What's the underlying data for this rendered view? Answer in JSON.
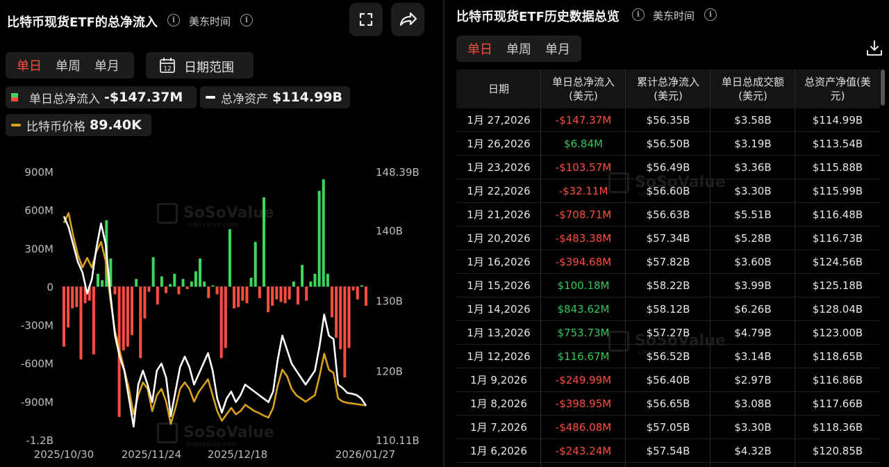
{
  "left": {
    "title": "比特币现货ETF的总净流入",
    "timezone": "美东时间",
    "tabs": [
      "单日",
      "单周",
      "单月"
    ],
    "active_tab": "单日",
    "date_range_label": "日期范围",
    "calendar_day": "12",
    "legend": {
      "daily_label": "单日总净流入",
      "daily_value": "-$147.37M",
      "assets_label": "总净资产",
      "assets_value": "$114.99B",
      "price_label": "比特币价格",
      "price_value": "89.40K"
    },
    "watermark": {
      "brand": "SoSoValue",
      "site": "sosovalue.com"
    }
  },
  "chart_data": {
    "type": "bar",
    "y_left": {
      "ticks": [
        "900M",
        "600M",
        "300M",
        "0",
        "-300M",
        "-600M",
        "-900M",
        "-1.2B"
      ],
      "range_m": [
        -1200,
        900
      ]
    },
    "y_right": {
      "ticks": [
        "148.39B",
        "140B",
        "130B",
        "120B",
        "110.11B"
      ],
      "range_b": [
        110.11,
        148.39
      ]
    },
    "x_labels": [
      "2025/10/30",
      "2025/11/24",
      "2025/12/18",
      "2026/01/27"
    ],
    "flows_m": [
      -470,
      -320,
      -170,
      -160,
      -570,
      -130,
      -110,
      -530,
      100,
      50,
      520,
      220,
      -60,
      -1020,
      -500,
      -470,
      -380,
      60,
      -560,
      -250,
      -40,
      230,
      -140,
      80,
      -50,
      20,
      100,
      -60,
      60,
      -20,
      40,
      120,
      220,
      40,
      -90,
      10,
      -60,
      -560,
      -480,
      450,
      -170,
      -160,
      -110,
      -130,
      70,
      350,
      -90,
      700,
      -200,
      -150,
      -100,
      -120,
      -130,
      -100,
      40,
      -140,
      170,
      -110,
      40,
      100,
      750,
      840,
      100,
      -240,
      -400,
      -490,
      -710,
      -480,
      -30,
      -100,
      10,
      -150
    ],
    "assets_b": [
      142.0,
      140.5,
      138.0,
      135.5,
      134.0,
      131.0,
      133.0,
      137.5,
      141.0,
      138.0,
      131.0,
      125.0,
      122.0,
      120.0,
      116.0,
      112.0,
      118.0,
      120.0,
      118.0,
      115.5,
      120.0,
      121.0,
      119.0,
      113.5,
      117.0,
      120.5,
      122.0,
      120.5,
      118.0,
      119.5,
      121.0,
      122.5,
      120.0,
      116.0,
      114.0,
      116.0,
      117.0,
      115.5,
      116.5,
      118.0,
      117.5,
      117.0,
      116.5,
      116.0,
      115.5,
      117.0,
      121.5,
      125.0,
      123.0,
      121.0,
      120.0,
      119.0,
      118.0,
      119.0,
      120.0,
      123.5,
      128.0,
      125.0,
      124.5,
      118.0,
      117.5,
      116.8,
      116.7,
      116.5,
      116.0,
      114.99
    ],
    "price_k": [
      118.0,
      119.5,
      116.0,
      113.0,
      111.0,
      112.5,
      111.0,
      113.5,
      115.0,
      112.0,
      106.0,
      101.0,
      98.0,
      95.0,
      92.0,
      88.0,
      91.0,
      93.0,
      92.0,
      88.5,
      91.0,
      92.0,
      90.0,
      86.5,
      89.0,
      92.0,
      93.0,
      92.0,
      90.0,
      91.5,
      92.5,
      93.5,
      91.0,
      88.5,
      87.0,
      88.0,
      89.0,
      88.0,
      88.5,
      89.5,
      89.0,
      88.5,
      88.2,
      87.8,
      87.5,
      89.0,
      92.5,
      95.0,
      94.0,
      92.0,
      91.0,
      90.5,
      90.0,
      90.5,
      91.0,
      94.0,
      97.5,
      95.0,
      94.5,
      90.5,
      90.0,
      89.8,
      89.7,
      89.6,
      89.5,
      89.4
    ],
    "price_range_k": [
      84.0,
      126.0
    ],
    "colors": {
      "inflow": "#3dd65c",
      "outflow": "#ff4d40",
      "assets": "#ffffff",
      "price": "#d9a21b"
    }
  },
  "right": {
    "title": "比特币现货ETF历史数据总览",
    "timezone": "美东时间",
    "tabs": [
      "单日",
      "单周",
      "单月"
    ],
    "active_tab": "单日",
    "columns": [
      "日期",
      "单日总净流入\n(美元)",
      "累计总净流入\n(美元)",
      "单日总成交额\n(美元)",
      "总资产净值(美\n元)"
    ],
    "rows": [
      [
        "1月 27,2026",
        "-$147.37M",
        "$56.35B",
        "$3.58B",
        "$114.99B"
      ],
      [
        "1月 26,2026",
        "$6.84M",
        "$56.50B",
        "$3.19B",
        "$113.54B"
      ],
      [
        "1月 23,2026",
        "-$103.57M",
        "$56.49B",
        "$3.36B",
        "$115.88B"
      ],
      [
        "1月 22,2026",
        "-$32.11M",
        "$56.60B",
        "$3.30B",
        "$115.99B"
      ],
      [
        "1月 21,2026",
        "-$708.71M",
        "$56.63B",
        "$5.51B",
        "$116.48B"
      ],
      [
        "1月 20,2026",
        "-$483.38M",
        "$57.34B",
        "$5.28B",
        "$116.73B"
      ],
      [
        "1月 16,2026",
        "-$394.68M",
        "$57.82B",
        "$3.60B",
        "$124.56B"
      ],
      [
        "1月 15,2026",
        "$100.18M",
        "$58.22B",
        "$3.99B",
        "$125.18B"
      ],
      [
        "1月 14,2026",
        "$843.62M",
        "$58.12B",
        "$6.26B",
        "$128.04B"
      ],
      [
        "1月 13,2026",
        "$753.73M",
        "$57.27B",
        "$4.79B",
        "$123.00B"
      ],
      [
        "1月 12,2026",
        "$116.67M",
        "$56.52B",
        "$3.14B",
        "$118.65B"
      ],
      [
        "1月 9,2026",
        "-$249.99M",
        "$56.40B",
        "$2.97B",
        "$116.86B"
      ],
      [
        "1月 8,2026",
        "-$398.95M",
        "$56.65B",
        "$3.08B",
        "$117.66B"
      ],
      [
        "1月 7,2026",
        "-$486.08M",
        "$57.05B",
        "$3.30B",
        "$118.36B"
      ],
      [
        "1月 6,2026",
        "-$243.24M",
        "$57.54B",
        "$4.32B",
        "$120.85B"
      ]
    ]
  }
}
